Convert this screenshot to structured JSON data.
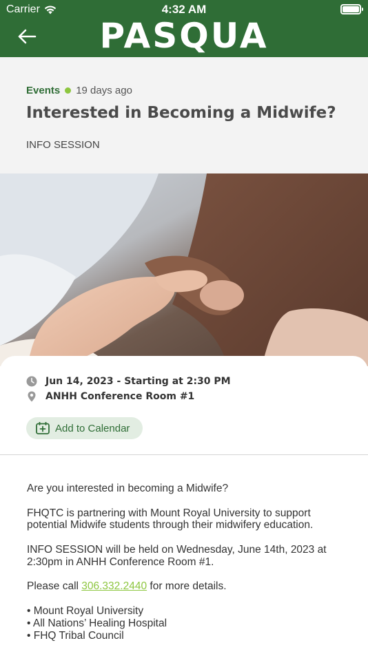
{
  "status_bar": {
    "carrier": "Carrier",
    "time": "4:32 AM"
  },
  "nav": {
    "logo_text": "PASQUA",
    "back_icon": "arrow-left-icon"
  },
  "post": {
    "category": "Events",
    "age": "19 days ago",
    "title": "Interested in Becoming a Midwife?",
    "subtitle": "INFO SESSION"
  },
  "event": {
    "datetime": "Jun 14, 2023 - Starting at 2:30 PM",
    "location": "ANHH Conference Room #1",
    "calendar_button": "Add to Calendar"
  },
  "body": {
    "p1": "Are you interested in becoming a Midwife?",
    "p2": "FHQTC is partnering with Mount Royal University to support potential Midwife students through their midwifery education.",
    "p3": "INFO SESSION will be held on Wednesday, June 14th, 2023 at 2:30pm in ANHH Conference Room #1.",
    "p4_before": "Please call ",
    "phone": "306.332.2440",
    "p4_after": " for more details.",
    "bullets": [
      "• Mount Royal University",
      "• All Nations’ Healing Hospital",
      "• FHQ Tribal Council"
    ]
  },
  "colors": {
    "brand_green": "#2f6d36",
    "accent_lime": "#8dc63f"
  }
}
